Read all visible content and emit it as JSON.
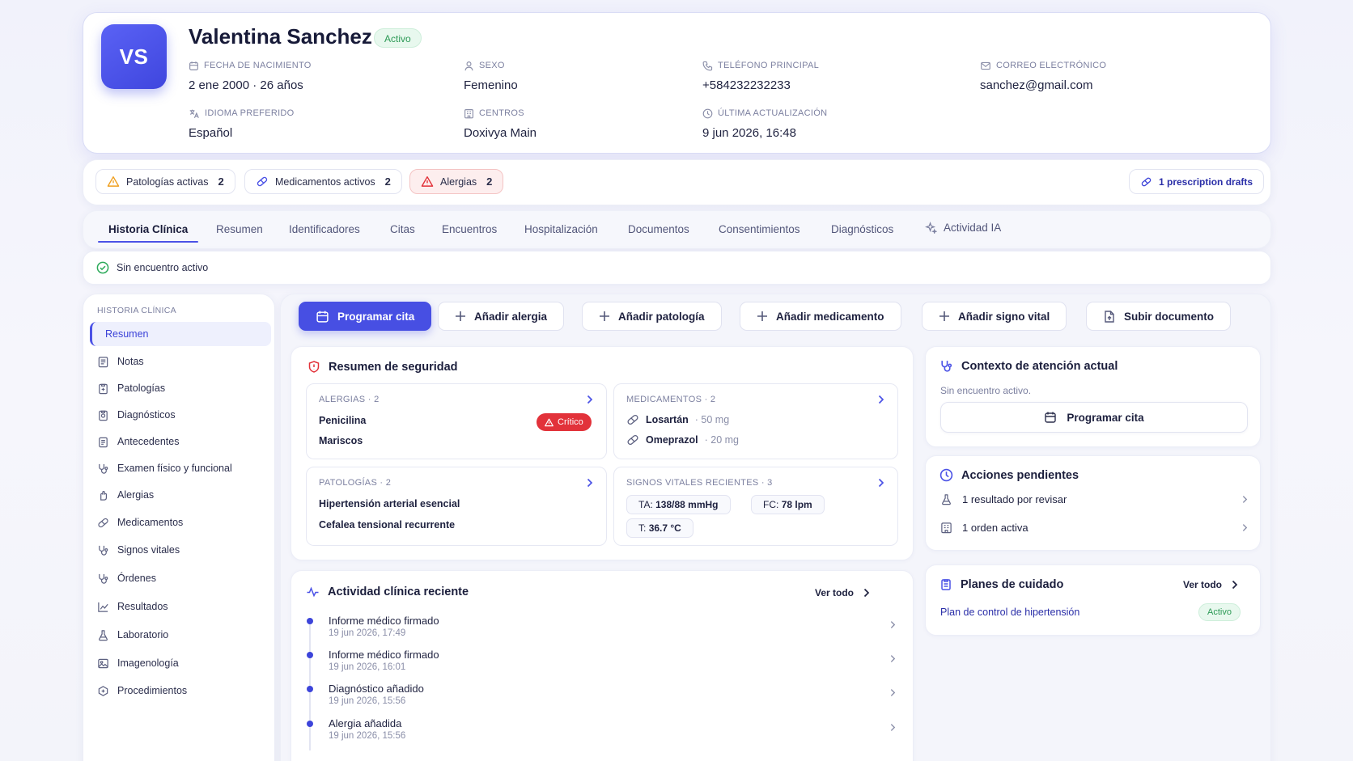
{
  "patient": {
    "initials": "VS",
    "name": "Valentina Sanchez",
    "status": "Activo",
    "fields": [
      {
        "label": "FECHA DE NACIMIENTO",
        "value": "2 ene 2000 · 26 años",
        "icon": "calendar-icon"
      },
      {
        "label": "SEXO",
        "value": "Femenino",
        "icon": "user-icon"
      },
      {
        "label": "TELÉFONO PRINCIPAL",
        "value": "+584232232233",
        "icon": "phone-icon"
      },
      {
        "label": "CORREO ELECTRÓNICO",
        "value": "sanchez@gmail.com",
        "icon": "mail-icon"
      },
      {
        "label": "IDIOMA PREFERIDO",
        "value": "Español",
        "icon": "language-icon"
      },
      {
        "label": "CENTROS",
        "value": "Doxivya Main",
        "icon": "building-icon"
      },
      {
        "label": "ÚLTIMA ACTUALIZACIÓN",
        "value": "9 jun 2026, 16:48",
        "icon": "clock-icon"
      }
    ]
  },
  "counts": {
    "pathologies_label": "Patologías activas",
    "pathologies": "2",
    "medications_label": "Medicamentos activos",
    "medications": "2",
    "allergies_label": "Alergias",
    "allergies": "2",
    "drafts": "1 prescription drafts"
  },
  "tabs": [
    "Historia Clínica",
    "Resumen",
    "Identificadores",
    "Citas",
    "Encuentros",
    "Hospitalización",
    "Documentos",
    "Consentimientos",
    "Diagnósticos",
    "Actividad IA"
  ],
  "encounter_status": "Sin encuentro activo",
  "sidebar": {
    "heading": "HISTORIA CLÍNICA",
    "items": [
      "Resumen",
      "Notas",
      "Patologías",
      "Diagnósticos",
      "Antecedentes",
      "Examen físico y funcional",
      "Alergias",
      "Medicamentos",
      "Signos vitales",
      "Órdenes",
      "Resultados",
      "Laboratorio",
      "Imagenología",
      "Procedimientos"
    ]
  },
  "actions": [
    "Programar cita",
    "Añadir alergia",
    "Añadir patología",
    "Añadir medicamento",
    "Añadir signo vital",
    "Subir documento"
  ],
  "safety": {
    "title": "Resumen de seguridad",
    "allergies_head": "ALERGIAS · 2",
    "allergies": [
      "Penicilina",
      "Mariscos"
    ],
    "critical": "Crítico",
    "meds_head": "MEDICAMENTOS · 2",
    "meds": [
      {
        "name": "Losartán",
        "dose": "· 50 mg"
      },
      {
        "name": "Omeprazol",
        "dose": "· 20 mg"
      }
    ],
    "path_head": "PATOLOGÍAS · 2",
    "pathologies": [
      "Hipertensión arterial esencial",
      "Cefalea tensional recurrente"
    ],
    "vitals_head": "SIGNOS VITALES RECIENTES · 3",
    "vitals": [
      {
        "k": "TA:",
        "v": "138/88 mmHg"
      },
      {
        "k": "FC:",
        "v": "78 lpm"
      },
      {
        "k": "T:",
        "v": "36.7 °C"
      }
    ]
  },
  "activity": {
    "title": "Actividad clínica reciente",
    "view_all": "Ver todo",
    "items": [
      {
        "title": "Informe médico firmado",
        "date": "19 jun 2026, 17:49"
      },
      {
        "title": "Informe médico firmado",
        "date": "19 jun 2026, 16:01"
      },
      {
        "title": "Diagnóstico añadido",
        "date": "19 jun 2026, 15:56"
      },
      {
        "title": "Alergia añadida",
        "date": "19 jun 2026, 15:56"
      }
    ]
  },
  "context": {
    "title": "Contexto de atención actual",
    "text": "Sin encuentro activo.",
    "button": "Programar cita"
  },
  "pending": {
    "title": "Acciones pendientes",
    "items": [
      "1 resultado por revisar",
      "1 orden activa"
    ]
  },
  "plans": {
    "title": "Planes de cuidado",
    "view_all": "Ver todo",
    "plan": "Plan de control de hipertensión",
    "status": "Activo"
  },
  "colors": {
    "primary": "#474fe3",
    "success": "#2d9a56",
    "danger": "#e2323a",
    "text": "#1b1e3c",
    "muted": "#7c80a0"
  }
}
